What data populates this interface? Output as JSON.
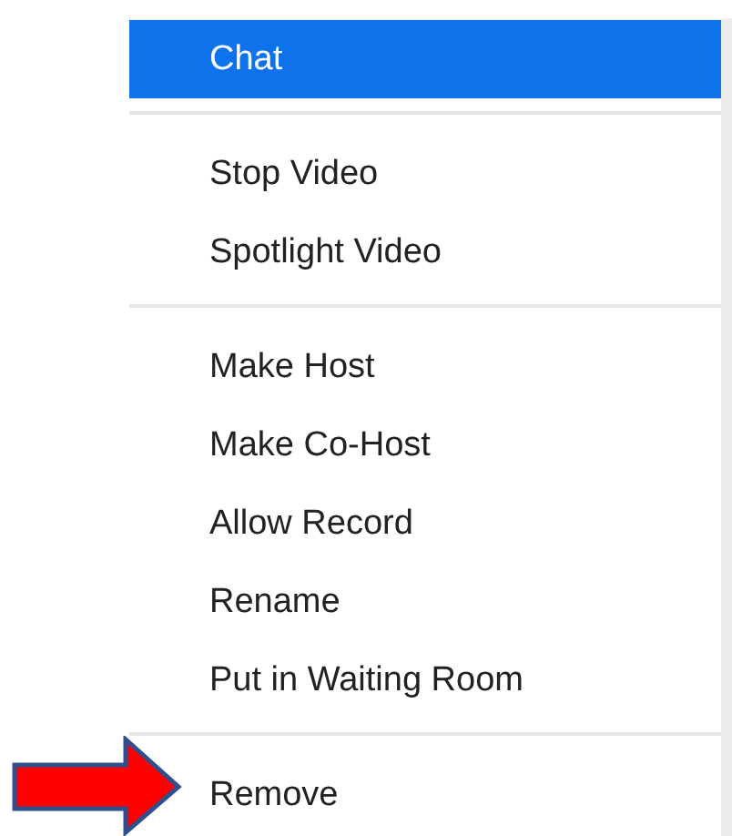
{
  "menu": {
    "groups": [
      {
        "items": [
          {
            "label": "Chat",
            "selected": true
          }
        ]
      },
      {
        "items": [
          {
            "label": "Stop Video",
            "selected": false
          },
          {
            "label": "Spotlight Video",
            "selected": false
          }
        ]
      },
      {
        "items": [
          {
            "label": "Make Host",
            "selected": false
          },
          {
            "label": "Make Co-Host",
            "selected": false
          },
          {
            "label": "Allow Record",
            "selected": false
          },
          {
            "label": "Rename",
            "selected": false
          },
          {
            "label": "Put in Waiting Room",
            "selected": false
          }
        ]
      },
      {
        "items": [
          {
            "label": "Remove",
            "selected": false
          }
        ]
      }
    ]
  }
}
